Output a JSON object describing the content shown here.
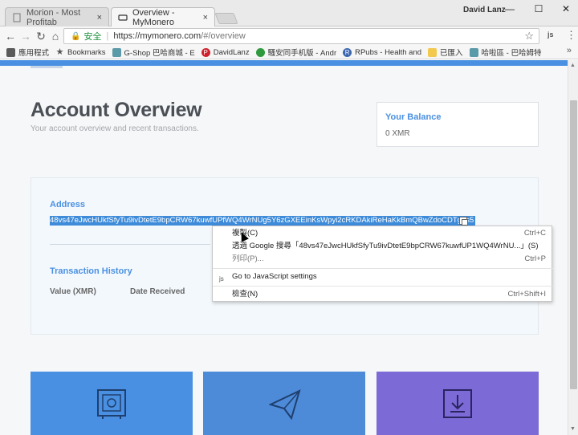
{
  "browser": {
    "tabs": [
      {
        "title": "Morion - Most Profitab",
        "close": "×"
      },
      {
        "title": "Overview - MyMonero",
        "close": "×"
      }
    ],
    "user": "David Lanz",
    "window_controls": {
      "minimize": "—",
      "maximize": "☐",
      "close": "✕"
    },
    "nav": {
      "back": "←",
      "forward": "→",
      "reload": "↻",
      "home": "⌂"
    },
    "omnibox": {
      "lock": "🔒",
      "secure_label": "安全",
      "url_host": "https://mymonero.com",
      "url_path": "/#/overview",
      "star": "☆"
    },
    "extension": "js",
    "menu": "⋮"
  },
  "bookmarks": [
    {
      "label": "應用程式",
      "icon": "apps-icon"
    },
    {
      "label": "Bookmarks",
      "icon": "star-icon"
    },
    {
      "label": "G-Shop 巴哈商城 - E",
      "icon": "bird-icon"
    },
    {
      "label": "DavidLanz",
      "icon": "pinterest-icon"
    },
    {
      "label": "騷安同手机版 - Andr",
      "icon": "green-icon"
    },
    {
      "label": "RPubs - Health and",
      "icon": "r-icon"
    },
    {
      "label": "已匯入",
      "icon": "folder-icon"
    },
    {
      "label": "哈啦區 - 巴哈姆特",
      "icon": "bird-icon"
    }
  ],
  "bookmarks_more": "»",
  "page": {
    "title": "Account Overview",
    "subtitle": "Your account overview and recent transactions.",
    "balance": {
      "label": "Your Balance",
      "value": "0 XMR"
    },
    "address": {
      "label": "Address",
      "value": "48vs47eJwcHUkfSfyTu9ivDtetE9bpCRW67kuwfUPfWQ4WrNUg5Y6zGXEEinKsWpyi2cRKDAkiReHaKkBmQBwZdoCDTg7s5"
    },
    "transactions": {
      "label": "Transaction History",
      "columns": [
        "Value (XMR)",
        "Date Received"
      ]
    },
    "tiles": [
      {
        "name": "receive-tile",
        "color": "#4a90e2",
        "icon": "safe-icon"
      },
      {
        "name": "send-tile",
        "color": "#4d8ad8",
        "icon": "paper-plane-icon"
      },
      {
        "name": "download-tile",
        "color": "#7c6bd6",
        "icon": "download-icon"
      }
    ]
  },
  "context_menu": {
    "items": [
      {
        "label": "複製(C)",
        "shortcut": "Ctrl+C"
      },
      {
        "label": "透過 Google 搜尋「48vs47eJwcHUkfSfyTu9ivDtetE9bpCRW67kuwfUP1WQ4WrNU...」(S)",
        "shortcut": ""
      },
      {
        "label": "列印(P)...",
        "shortcut": "Ctrl+P"
      },
      {
        "label": "Go to JavaScript settings",
        "shortcut": ""
      },
      {
        "label": "檢查(N)",
        "shortcut": "Ctrl+Shift+I"
      }
    ]
  }
}
